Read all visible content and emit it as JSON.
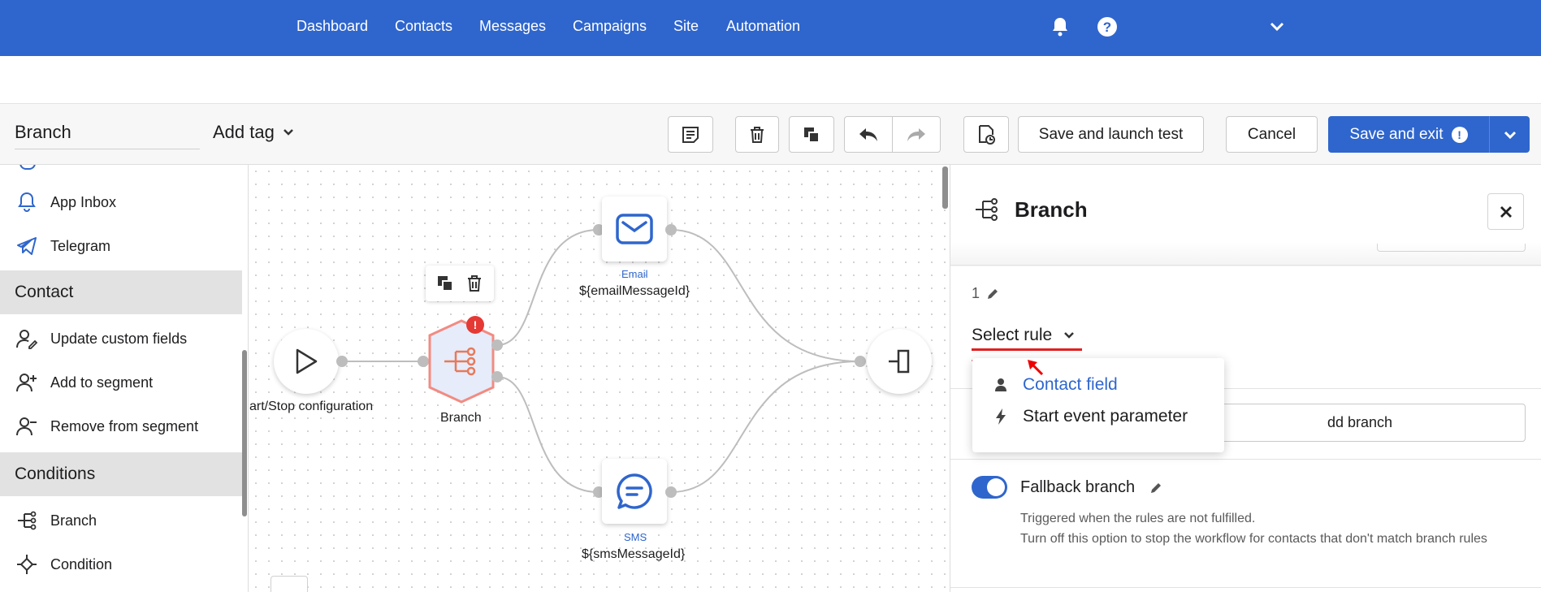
{
  "nav": {
    "items": [
      "Dashboard",
      "Contacts",
      "Messages",
      "Campaigns",
      "Site",
      "Automation"
    ],
    "icons": [
      "bell-icon",
      "help-icon",
      "chevron-down-icon"
    ]
  },
  "toolbar": {
    "name_value": "Branch",
    "add_tag_label": "Add tag",
    "save_launch_label": "Save and launch test",
    "cancel_label": "Cancel",
    "save_exit_label": "Save and exit",
    "save_exit_warning": "!"
  },
  "sidebar": {
    "items_top": [
      {
        "label": "App Inbox",
        "icon": "bell-icon"
      },
      {
        "label": "Telegram",
        "icon": "paper-plane-icon"
      }
    ],
    "contact_header": "Contact",
    "contact_items": [
      {
        "label": "Update custom fields",
        "icon": "user-edit-icon"
      },
      {
        "label": "Add to segment",
        "icon": "user-add-icon"
      },
      {
        "label": "Remove from segment",
        "icon": "user-remove-icon"
      }
    ],
    "conditions_header": "Conditions",
    "condition_items": [
      {
        "label": "Branch",
        "icon": "branch-icon"
      },
      {
        "label": "Condition",
        "icon": "condition-icon"
      }
    ]
  },
  "canvas": {
    "start_label": "art/Stop configuration",
    "branch_label": "Branch",
    "branch_error": "!",
    "email_type": "Email",
    "email_label": "${emailMessageId}",
    "sms_type": "SMS",
    "sms_label": "${smsMessageId}"
  },
  "panel": {
    "title": "Branch",
    "rule_number": "1",
    "select_rule_label": "Select rule",
    "add_branch_label": "dd branch",
    "fallback_label": "Fallback branch",
    "fallback_enabled": true,
    "fallback_desc_1": "Triggered when the rules are not fulfilled.",
    "fallback_desc_2": "Turn off this option to stop the workflow for contacts that don't match branch rules"
  },
  "dropdown": {
    "options": [
      {
        "label": "Contact field",
        "icon": "person-icon",
        "highlighted": true
      },
      {
        "label": "Start event parameter",
        "icon": "lightning-icon",
        "highlighted": false
      }
    ]
  },
  "colors": {
    "brand": "#2f66cd",
    "error": "#e02020",
    "branch_node": "#e8795a"
  }
}
